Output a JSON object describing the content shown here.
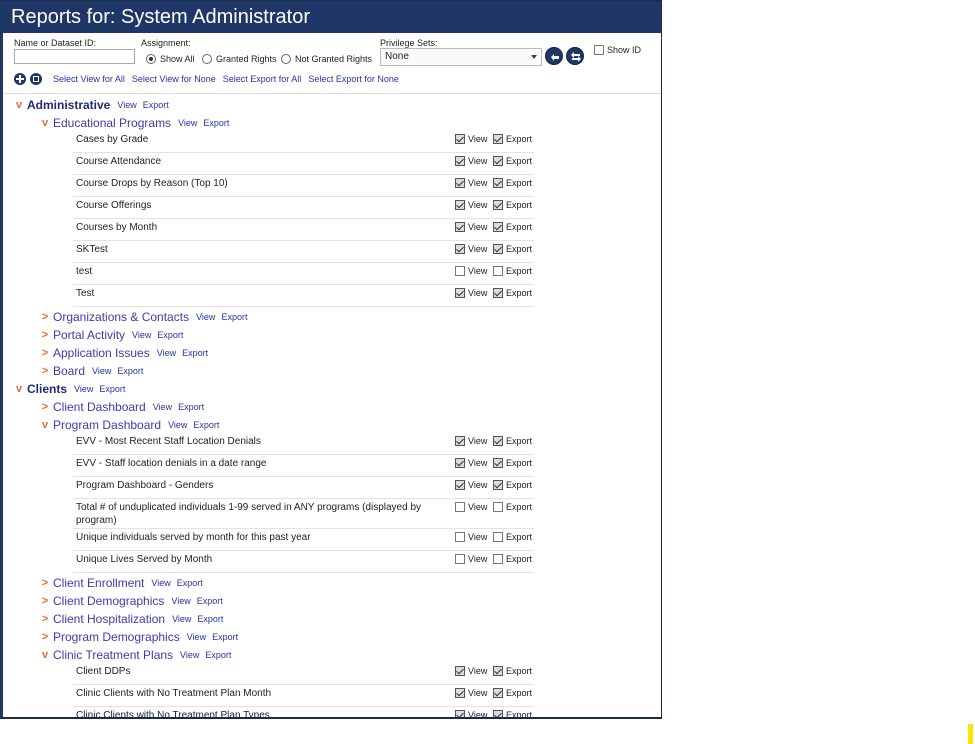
{
  "title": "Reports for: System Administrator",
  "filters": {
    "name_label": "Name or Dataset ID:",
    "name_value": "",
    "assignment_label": "Assignment:",
    "assignment_options": [
      "Show All",
      "Granted Rights",
      "Not Granted Rights"
    ],
    "assignment_selected": "Show All",
    "privilege_label": "Privilege Sets:",
    "privilege_value": "None",
    "show_id_label": "Show ID",
    "show_id_checked": false
  },
  "bulk_actions": {
    "select_view_all": "Select View for All",
    "select_view_none": "Select View for None",
    "select_export_all": "Select Export for All",
    "select_export_none": "Select Export for None"
  },
  "labels": {
    "view": "View",
    "export": "Export"
  },
  "tree": [
    {
      "type": "category",
      "label": "Administrative",
      "expanded": true
    },
    {
      "type": "group",
      "label": "Educational Programs",
      "expanded": true
    },
    {
      "type": "report",
      "label": "Cases by Grade",
      "view": true,
      "export": true
    },
    {
      "type": "report",
      "label": "Course Attendance",
      "view": true,
      "export": true
    },
    {
      "type": "report",
      "label": "Course Drops by Reason (Top 10)",
      "view": true,
      "export": true
    },
    {
      "type": "report",
      "label": "Course Offerings",
      "view": true,
      "export": true
    },
    {
      "type": "report",
      "label": "Courses by Month",
      "view": true,
      "export": true
    },
    {
      "type": "report",
      "label": "SKTest",
      "view": true,
      "export": true
    },
    {
      "type": "report",
      "label": "test",
      "view": false,
      "export": false
    },
    {
      "type": "report",
      "label": "Test",
      "view": true,
      "export": true
    },
    {
      "type": "group",
      "label": "Organizations & Contacts",
      "expanded": false
    },
    {
      "type": "group",
      "label": "Portal Activity",
      "expanded": false
    },
    {
      "type": "group",
      "label": "Application Issues",
      "expanded": false
    },
    {
      "type": "group",
      "label": "Board",
      "expanded": false
    },
    {
      "type": "category",
      "label": "Clients",
      "expanded": true
    },
    {
      "type": "group",
      "label": "Client Dashboard",
      "expanded": false
    },
    {
      "type": "group",
      "label": "Program Dashboard",
      "expanded": true
    },
    {
      "type": "report",
      "label": "EVV - Most Recent Staff Location Denials",
      "view": true,
      "export": true
    },
    {
      "type": "report",
      "label": "EVV - Staff location denials in a date range",
      "view": true,
      "export": true
    },
    {
      "type": "report",
      "label": "Program Dashboard - Genders",
      "view": true,
      "export": true
    },
    {
      "type": "report",
      "label": "Total # of unduplicated individuals 1-99 served in ANY programs (displayed by program)",
      "view": false,
      "export": false
    },
    {
      "type": "report",
      "label": "Unique individuals served by month for this past year",
      "view": false,
      "export": false
    },
    {
      "type": "report",
      "label": "Unique Lives Served by Month",
      "view": false,
      "export": false
    },
    {
      "type": "group",
      "label": "Client Enrollment",
      "expanded": false
    },
    {
      "type": "group",
      "label": "Client Demographics",
      "expanded": false
    },
    {
      "type": "group",
      "label": "Client Hospitalization",
      "expanded": false
    },
    {
      "type": "group",
      "label": "Program Demographics",
      "expanded": false
    },
    {
      "type": "group",
      "label": "Clinic Treatment Plans",
      "expanded": true
    },
    {
      "type": "report",
      "label": "Client DDPs",
      "view": true,
      "export": true
    },
    {
      "type": "report",
      "label": "Clinic Clients with No Treatment Plan Month",
      "view": true,
      "export": true
    },
    {
      "type": "report",
      "label": "Clinic Clients with No Treatment Plan Types",
      "view": true,
      "export": true
    }
  ],
  "colors": {
    "titlebar": "#1f3766",
    "chevron": "#e36b2f",
    "link": "#2433a8"
  }
}
